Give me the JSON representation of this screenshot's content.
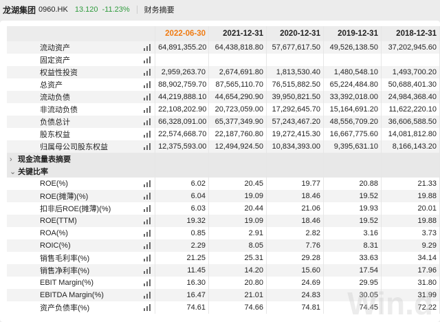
{
  "header": {
    "company": "龙湖集团",
    "code": "0960.HK",
    "price": "13.120",
    "change": "-11.23%",
    "section": "财务摘要"
  },
  "columns": [
    "2022-06-30",
    "2021-12-31",
    "2020-12-31",
    "2019-12-31",
    "2018-12-31"
  ],
  "balance_rows": [
    {
      "label": "流动资产",
      "values": [
        "64,891,355.20",
        "64,438,818.80",
        "57,677,617.50",
        "49,526,138.50",
        "37,202,945.60"
      ]
    },
    {
      "label": "固定资产",
      "values": [
        "",
        "",
        "",
        "",
        ""
      ]
    },
    {
      "label": "权益性投资",
      "values": [
        "2,959,263.70",
        "2,674,691.80",
        "1,813,530.40",
        "1,480,548.10",
        "1,493,700.20"
      ]
    },
    {
      "label": "总资产",
      "values": [
        "88,902,759.70",
        "87,565,110.70",
        "76,515,882.50",
        "65,224,484.80",
        "50,688,401.30"
      ]
    },
    {
      "label": "流动负债",
      "values": [
        "44,219,888.10",
        "44,654,290.90",
        "39,950,821.50",
        "33,392,018.00",
        "24,984,368.40"
      ]
    },
    {
      "label": "非流动负债",
      "values": [
        "22,108,202.90",
        "20,723,059.00",
        "17,292,645.70",
        "15,164,691.20",
        "11,622,220.10"
      ]
    },
    {
      "label": "负债总计",
      "values": [
        "66,328,091.00",
        "65,377,349.90",
        "57,243,467.20",
        "48,556,709.20",
        "36,606,588.50"
      ]
    },
    {
      "label": "股东权益",
      "values": [
        "22,574,668.70",
        "22,187,760.80",
        "19,272,415.30",
        "16,667,775.60",
        "14,081,812.80"
      ]
    },
    {
      "label": "归属母公司股东权益",
      "values": [
        "12,375,593.00",
        "12,494,924.50",
        "10,834,393.00",
        "9,395,631.10",
        "8,166,143.20"
      ]
    }
  ],
  "sections": {
    "cashflow": "现金流量表摘要",
    "ratios": "关键比率"
  },
  "ratio_rows": [
    {
      "label": "ROE(%)",
      "values": [
        "6.02",
        "20.45",
        "19.77",
        "20.88",
        "21.33"
      ]
    },
    {
      "label": "ROE(摊薄)(%)",
      "values": [
        "6.04",
        "19.09",
        "18.46",
        "19.52",
        "19.88"
      ]
    },
    {
      "label": "扣非后ROE(摊薄)(%)",
      "values": [
        "6.03",
        "20.44",
        "21.06",
        "19.93",
        "20.01"
      ]
    },
    {
      "label": "ROE(TTM)",
      "values": [
        "19.32",
        "19.09",
        "18.46",
        "19.52",
        "19.88"
      ]
    },
    {
      "label": "ROA(%)",
      "values": [
        "0.85",
        "2.91",
        "2.82",
        "3.16",
        "3.73"
      ]
    },
    {
      "label": "ROIC(%)",
      "values": [
        "2.29",
        "8.05",
        "7.76",
        "8.31",
        "9.29"
      ]
    },
    {
      "label": "销售毛利率(%)",
      "values": [
        "21.25",
        "25.31",
        "29.28",
        "33.63",
        "34.14"
      ]
    },
    {
      "label": "销售净利率(%)",
      "values": [
        "11.45",
        "14.20",
        "15.60",
        "17.54",
        "17.96"
      ]
    },
    {
      "label": "EBIT Margin(%)",
      "values": [
        "16.30",
        "20.80",
        "24.69",
        "29.95",
        "31.80"
      ]
    },
    {
      "label": "EBITDA Margin(%)",
      "values": [
        "16.47",
        "21.01",
        "24.83",
        "30.05",
        "31.99"
      ]
    },
    {
      "label": "资产负债率(%)",
      "values": [
        "74.61",
        "74.66",
        "74.81",
        "74.45",
        "72.22"
      ]
    }
  ],
  "watermark": "Win.d"
}
